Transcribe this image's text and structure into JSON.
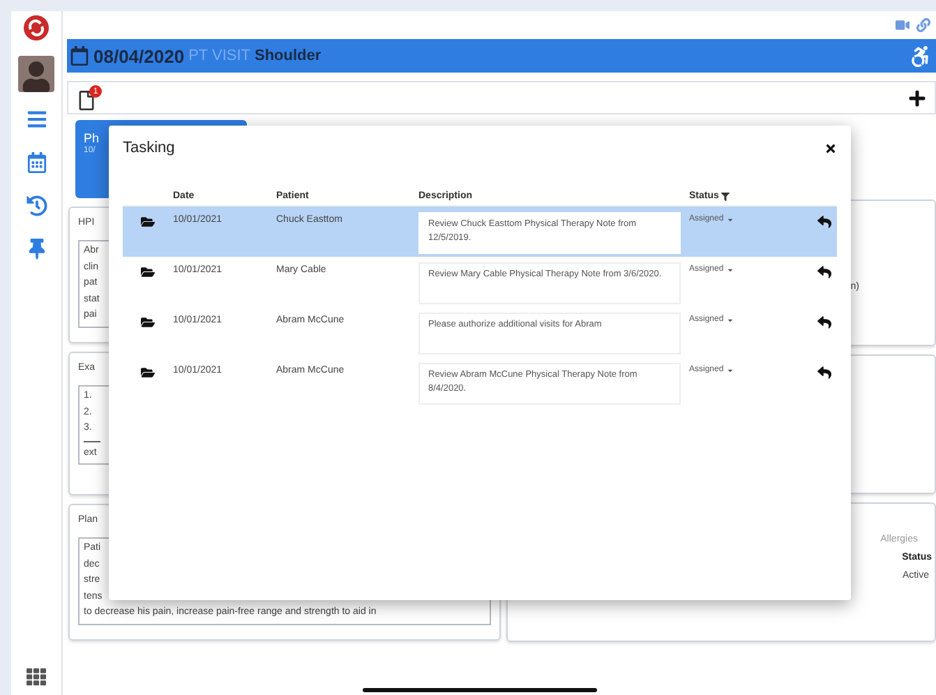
{
  "header": {
    "date": "08/04/2020",
    "visit_type": "PT VISIT",
    "title": "Shoulder"
  },
  "toolbar": {
    "badge": "1"
  },
  "summary_card": {
    "title": "Ph",
    "subtitle": "10/"
  },
  "left_cards": [
    {
      "kind": "text",
      "label": "HPI",
      "lines": [
        "Abr",
        "clin",
        "pat",
        "stat",
        "pai"
      ]
    },
    {
      "kind": "list",
      "label": "Exa",
      "lines": [
        "1.",
        "2.",
        "3."
      ],
      "footer": "ext"
    },
    {
      "kind": "text",
      "label": "Plan",
      "lines": [
        "Pati",
        "dec",
        "stre",
        "tens",
        "to decrease his pain, increase pain-free range and strength to aid in"
      ]
    }
  ],
  "right_panels": {
    "first": {
      "text": "n)"
    },
    "allergies": {
      "tab": "Allergies",
      "column": "Status",
      "value": "Active"
    }
  },
  "modal": {
    "title": "Tasking",
    "columns": [
      "Date",
      "Patient",
      "Description",
      "Status"
    ],
    "rows": [
      {
        "date": "10/01/2021",
        "patient": "Chuck Easttom",
        "description": "Review Chuck Easttom Physical Therapy  Note from 12/5/2019.",
        "status": "Assigned",
        "selected": true
      },
      {
        "date": "10/01/2021",
        "patient": "Mary Cable",
        "description": "Review Mary Cable Physical Therapy  Note from 3/6/2020.",
        "status": "Assigned",
        "selected": false
      },
      {
        "date": "10/01/2021",
        "patient": "Abram McCune",
        "description": "Please authorize additional visits for Abram",
        "status": "Assigned",
        "selected": false
      },
      {
        "date": "10/01/2021",
        "patient": "Abram McCune",
        "description": "Review Abram McCune Physical Therapy  Note from 8/4/2020.",
        "status": "Assigned",
        "selected": false
      }
    ]
  }
}
